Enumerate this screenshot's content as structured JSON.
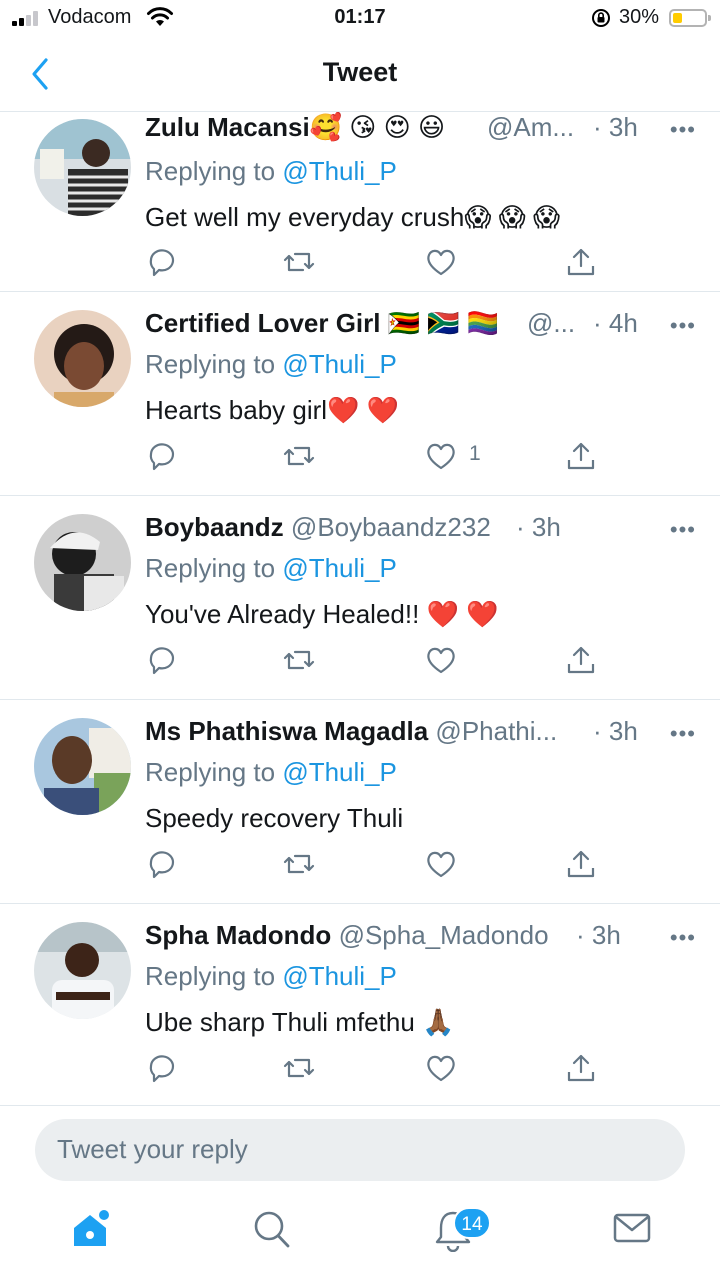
{
  "status_bar": {
    "carrier": "Vodacom",
    "time": "01:17",
    "battery_percent": "30%",
    "battery_level": 0.3,
    "signal_bars": 2
  },
  "nav": {
    "title": "Tweet",
    "back_icon": "chevron-left-icon"
  },
  "colors": {
    "accent": "#1da1f2",
    "link": "#1b95e0",
    "muted": "#657786",
    "divider": "#e1e8ed"
  },
  "replies": [
    {
      "name": "Zulu Macansi",
      "emojis": "🥰 😘 😍 😃",
      "handle": "@Am...",
      "time": "· 3h",
      "replying_label": "Replying to",
      "mention": "@Thuli_P",
      "text": "Get well my everyday crush😱 😱 😱",
      "like_count": ""
    },
    {
      "name": "Certified Lover Girl",
      "emojis": "🇿🇼 🇿🇦 🏳️‍🌈",
      "handle": "@...",
      "time": "· 4h",
      "replying_label": "Replying to",
      "mention": "@Thuli_P",
      "text": "Hearts baby girl❤️ ❤️",
      "like_count": "1"
    },
    {
      "name": "Boybaandz",
      "emojis": "",
      "handle": "@Boybaandz232",
      "time": "· 3h",
      "replying_label": "Replying to",
      "mention": "@Thuli_P",
      "text": "You've Already Healed!! ❤️ ❤️",
      "like_count": ""
    },
    {
      "name": "Ms Phathiswa Magadla",
      "emojis": "",
      "handle": "@Phathi...",
      "time": "· 3h",
      "replying_label": "Replying to",
      "mention": "@Thuli_P",
      "text": "Speedy recovery Thuli",
      "like_count": ""
    },
    {
      "name": "Spha Madondo",
      "emojis": "",
      "handle": "@Spha_Madondo",
      "time": "· 3h",
      "replying_label": "Replying to",
      "mention": "@Thuli_P",
      "text": "Ube sharp Thuli mfethu 🙏🏾",
      "like_count": ""
    }
  ],
  "more_label": "•••",
  "reply_box": {
    "placeholder": "Tweet your reply"
  },
  "tabbar": {
    "items": [
      "home-icon",
      "search-icon",
      "bell-icon",
      "mail-icon"
    ],
    "notifications_badge": "14"
  }
}
